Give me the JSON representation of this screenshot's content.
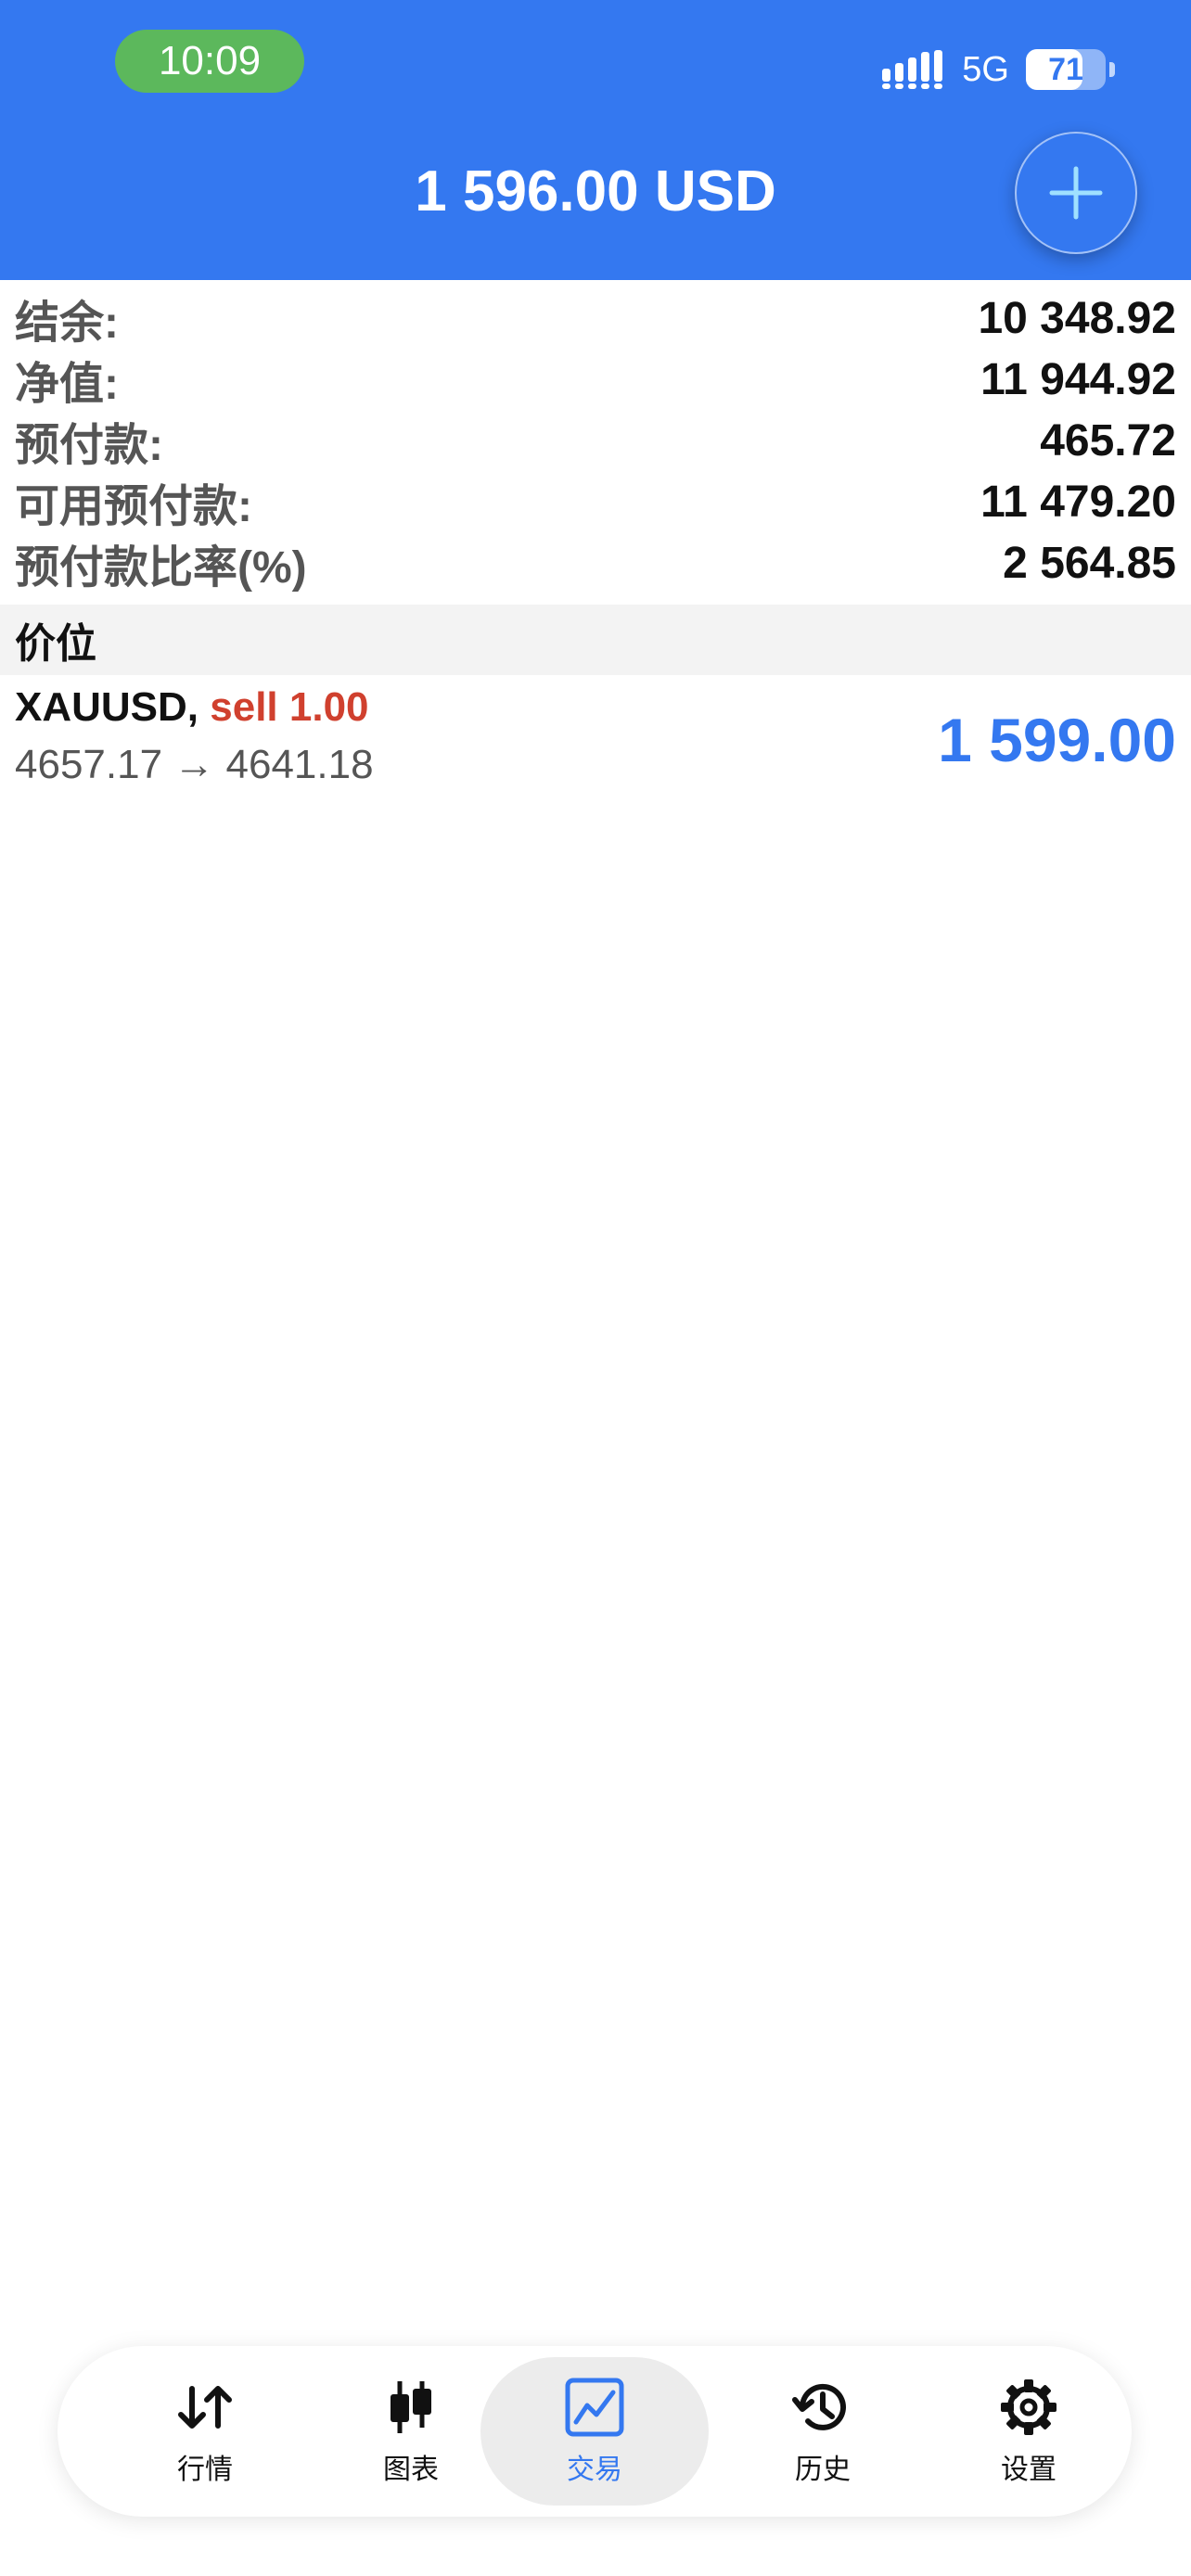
{
  "status_bar": {
    "time": "10:09",
    "network": "5G",
    "battery": "71",
    "battery_level": 0.71
  },
  "header": {
    "title": "1 596.00 USD",
    "add_icon": "plus-icon"
  },
  "summary": [
    {
      "label": "结余:",
      "value": "10 348.92"
    },
    {
      "label": "净值:",
      "value": "11 944.92"
    },
    {
      "label": "预付款:",
      "value": "465.72"
    },
    {
      "label": "可用预付款:",
      "value": "11 479.20"
    },
    {
      "label": "预付款比率(%)",
      "value": "2 564.85"
    }
  ],
  "section": {
    "title": "价位"
  },
  "position": {
    "symbol": "XAUUSD,",
    "side": "sell 1.00",
    "prices": "4657.17 → 4641.18",
    "profit": "1 599.00"
  },
  "tabs": [
    {
      "label": "行情",
      "icon": "arrows-updown-icon"
    },
    {
      "label": "图表",
      "icon": "candlestick-icon"
    },
    {
      "label": "交易",
      "icon": "trade-chart-icon",
      "active": true
    },
    {
      "label": "历史",
      "icon": "history-icon"
    },
    {
      "label": "设置",
      "icon": "gear-icon"
    }
  ],
  "colors": {
    "header": "#3478f0",
    "accent": "#3478f0",
    "sell": "#d0402e",
    "time_pill": "#5cb85c"
  }
}
